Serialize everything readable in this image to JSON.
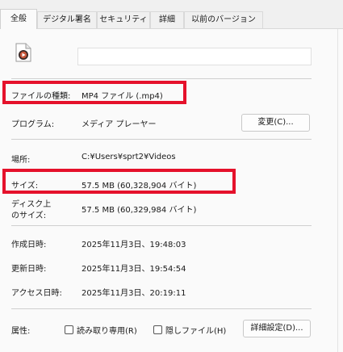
{
  "tabs": [
    {
      "label": "全般",
      "active": true
    },
    {
      "label": "デジタル署名",
      "active": false
    },
    {
      "label": "セキュリティ",
      "active": false
    },
    {
      "label": "詳細",
      "active": false
    },
    {
      "label": "以前のバージョン",
      "active": false
    }
  ],
  "file": {
    "name_value": "",
    "icon": "media-file-icon"
  },
  "properties": {
    "file_type": {
      "label": "ファイルの種類:",
      "value": "MP4 ファイル (.mp4)"
    },
    "program": {
      "label": "プログラム:",
      "value": "メディア プレーヤー",
      "change_button": "変更(C)..."
    },
    "location": {
      "label": "場所:",
      "value": "C:¥Users¥sprt2¥Videos"
    },
    "size": {
      "label": "サイズ:",
      "value": "57.5 MB (60,328,904 バイト)"
    },
    "size_on_disk": {
      "label_line1": "ディスク上",
      "label_line2": "のサイズ:",
      "value": "57.5 MB (60,329,984 バイト)"
    },
    "created": {
      "label": "作成日時:",
      "value": "2025年11月3日、19:48:03"
    },
    "modified": {
      "label": "更新日時:",
      "value": "2025年11月3日、19:54:54"
    },
    "accessed": {
      "label": "アクセス日時:",
      "value": "2025年11月3日、20:19:11"
    },
    "attributes": {
      "label": "属性:",
      "readonly_label": "読み取り専用(R)",
      "hidden_label": "隠しファイル(H)",
      "advanced_button": "詳細設定(D)..."
    }
  },
  "colors": {
    "highlight": "#e5112b",
    "panel_bg": "#fafafa",
    "window_bg": "#f0f0f0"
  }
}
